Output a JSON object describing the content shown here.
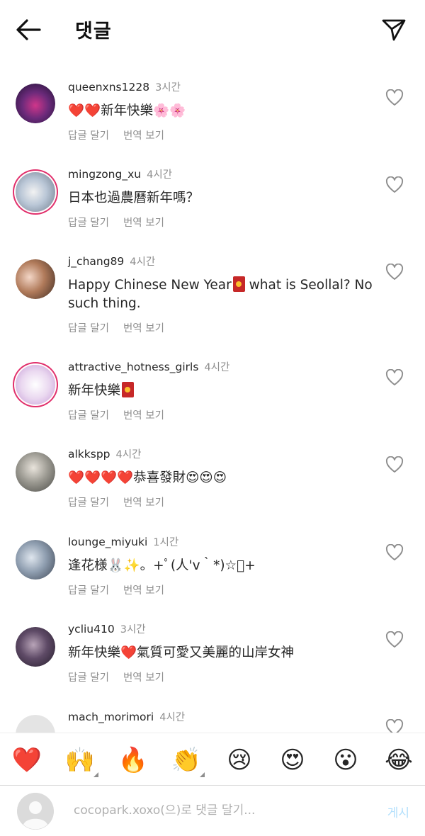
{
  "header": {
    "title": "댓글"
  },
  "comments": [
    {
      "username": "queenxns1228",
      "time": "3시간",
      "text": "❤️❤️新年快樂🌸🌸",
      "reply": "답글 달기",
      "translate": "번역 보기"
    },
    {
      "username": "mingzong_xu",
      "time": "4시간",
      "text": "日本也過農曆新年嗎？",
      "reply": "답글 달기",
      "translate": "번역 보기"
    },
    {
      "username": "j_chang89",
      "time": "4시간",
      "text_before": "Happy Chinese New Year",
      "text_after": " what is Seollal? No such thing.",
      "reply": "답글 달기",
      "translate": "번역 보기"
    },
    {
      "username": "attractive_hotness_girls",
      "time": "4시간",
      "text_before": "新年快樂",
      "reply": "답글 달기",
      "translate": "번역 보기"
    },
    {
      "username": "alkkspp",
      "time": "4시간",
      "text": "❤️❤️❤️❤️恭喜發財😍😍😍",
      "reply": "답글 달기",
      "translate": "번역 보기"
    },
    {
      "username": "lounge_miyuki",
      "time": "1시간",
      "text": "逢花様🐰✨。+ﾟ(人'v｀*)☆ﾟ+",
      "reply": "답글 달기",
      "translate": "번역 보기"
    },
    {
      "username": "ycliu410",
      "time": "3시간",
      "text": "新年快樂❤️氣質可愛又美麗的山岸女神",
      "reply": "답글 달기",
      "translate": "번역 보기"
    },
    {
      "username": "mach_morimori",
      "time": "4시간"
    }
  ],
  "reactions": [
    "❤️",
    "🙌",
    "🔥",
    "👏",
    "😢",
    "😍",
    "😮",
    "😂"
  ],
  "composer": {
    "placeholder": "cocopark.xoxo(으)로 댓글 달기...",
    "post": "게시"
  },
  "colors": {
    "link": "#b2dffc",
    "muted": "#8e8e8e",
    "text": "#262626",
    "story_ring": "#e1306c"
  }
}
